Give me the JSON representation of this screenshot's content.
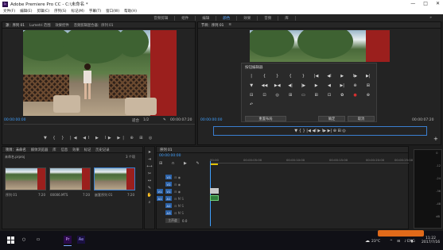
{
  "app": {
    "title": "Adobe Premiere Pro CC - C:\\未命名 *",
    "logo": "Pr",
    "window_buttons": [
      "—",
      "□",
      "✕"
    ]
  },
  "menu": [
    "文件(F)",
    "编辑(E)",
    "剪辑(C)",
    "序列(S)",
    "标记(M)",
    "字幕(T)",
    "窗口(W)",
    "帮助(H)"
  ],
  "workspaces": {
    "items": [
      "音频剪辑",
      "组件",
      "编辑",
      "颜色",
      "效果",
      "音频",
      "库"
    ],
    "active_index": 3,
    "more": "»"
  },
  "source": {
    "tabs": [
      "源：序列 01",
      "Lumetri 范围",
      "效果控件",
      "音频剪辑混合器：序列 01"
    ],
    "timecode_left": "00:00:00:00",
    "fit": "适合",
    "ratio": "1/2",
    "timecode_right": "00:00:07:20",
    "controls": "▼ { } |◀ ◀I ▶ I▶ ▶| ⊕ ⊞ ◎"
  },
  "program": {
    "tabs": [
      "节目：序列 01",
      "≡"
    ],
    "timecode_left": "00:00:00:00",
    "timecode_right": "00:00:07:20",
    "controls": "▼ { } |◀ ◀I ▶ I▶ ▶| ⊕ ⊞ ◎",
    "add": "+"
  },
  "button_editor": {
    "title": "按钮编辑器",
    "icons": [
      "|",
      "{",
      "}",
      "{",
      "}",
      "|◀",
      "◀I",
      "▶",
      "I▶",
      "▶|",
      "▼",
      "◀◀",
      "▶◀",
      "◀|",
      "|▶",
      "▶",
      "◀",
      "▶|",
      "⊕",
      "⊞",
      "⊟",
      "⊡",
      "◎",
      "⊞",
      "▭",
      "⊞",
      "⊡",
      "✿",
      "●",
      "⊕",
      "↶",
      "",
      "",
      "",
      "",
      "",
      "",
      "",
      "",
      ""
    ],
    "reset_label": "重置布局",
    "ok_label": "确定",
    "cancel_label": "取消"
  },
  "project": {
    "tabs": [
      "项目：未命名",
      "媒体浏览器",
      "库",
      "信息",
      "效果",
      "标记",
      "历史记录"
    ],
    "path": "未命名.prproj",
    "count": "3 个项",
    "items": [
      {
        "name": "序列 01",
        "duration": "7:20"
      },
      {
        "name": "00006.MTS",
        "duration": "7:20"
      },
      {
        "name": "嵌套序列 01",
        "duration": "7:20"
      }
    ]
  },
  "timeline": {
    "tab": "序列 01",
    "timecode": "00:00:00:00",
    "ruler": [
      "00:00",
      "00:00:05:00",
      "00:00:10:00",
      "00:00:15:00",
      "00:00:20:00",
      "00:00:25:00"
    ],
    "video_tracks": [
      {
        "label": "V3",
        "target": "V3"
      },
      {
        "label": "V2",
        "target": "V2"
      },
      {
        "label": "V1",
        "target": "V1"
      }
    ],
    "audio_tracks": [
      {
        "label": "A1",
        "target": "A1"
      },
      {
        "label": "A2",
        "target": "A2"
      },
      {
        "label": "A3",
        "target": "A3"
      }
    ],
    "master": "主声道",
    "master_value": "0.0"
  },
  "meters": {
    "labels": [
      "0",
      "-12",
      "-24",
      "-36",
      "-48",
      "dB"
    ]
  },
  "taskbar": {
    "start_icon": "windows-icon",
    "apps": [
      "○",
      "▭",
      "Pr",
      "Ae"
    ],
    "tray": [
      "☁",
      "ENG"
    ],
    "weather": "23°C",
    "time": "11:22",
    "date": "2017/7/16"
  }
}
